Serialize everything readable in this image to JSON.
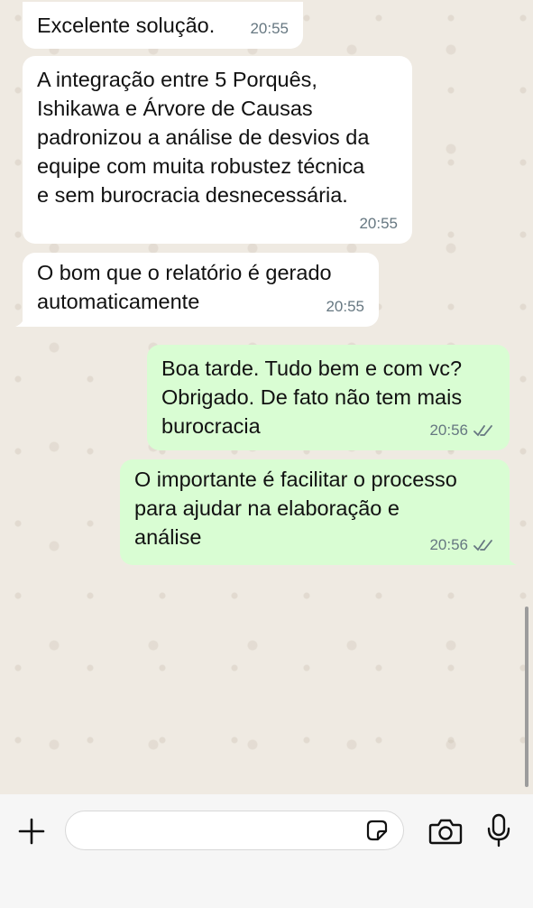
{
  "messages": [
    {
      "direction": "in",
      "text": "Excelente solução.",
      "time": "20:55"
    },
    {
      "direction": "in",
      "text": "A integração entre 5 Porquês,\nIshikawa e Árvore de Causas\npadronizou a análise de desvios da\nequipe com muita robustez técnica\ne sem burocracia desnecessária.",
      "time": "20:55"
    },
    {
      "direction": "in",
      "text": "O bom que o relatório é gerado\nautomaticamente",
      "time": "20:55"
    },
    {
      "direction": "out",
      "text": "Boa tarde. Tudo bem e com vc?\nObrigado. De fato não tem mais\nburocracia",
      "time": "20:56",
      "status": "read"
    },
    {
      "direction": "out",
      "text": "O importante é facilitar o processo\npara ajudar na elaboração e\nanálise",
      "time": "20:56",
      "status": "read"
    }
  ],
  "composer": {
    "value": "",
    "icons": [
      "plus-icon",
      "sticker-icon",
      "camera-icon",
      "microphone-icon"
    ]
  },
  "colors": {
    "chat_background": "#efeae2",
    "incoming_bubble": "#ffffff",
    "outgoing_bubble": "#d9fdd3",
    "timestamp": "#667781",
    "read_checks": "#667781"
  }
}
